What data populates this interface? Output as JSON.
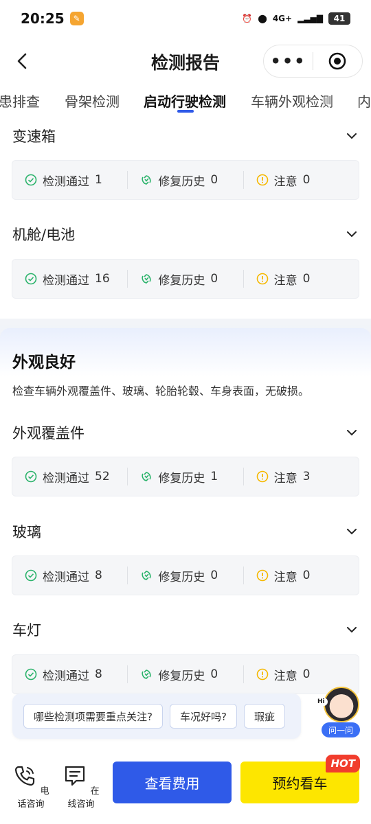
{
  "status_bar": {
    "time": "20:25",
    "network": "4G+",
    "battery": "41"
  },
  "nav": {
    "title": "检测报告",
    "more": "•••"
  },
  "tabs": [
    "患排查",
    "骨架检测",
    "启动行驶检测",
    "车辆外观检测",
    "内"
  ],
  "stat_labels": {
    "pass": "检测通过",
    "repair": "修复历史",
    "attention": "注意"
  },
  "top_sections": [
    {
      "title": "变速箱",
      "pass": "1",
      "repair": "0",
      "attention": "0"
    },
    {
      "title": "机舱/电池",
      "pass": "16",
      "repair": "0",
      "attention": "0"
    }
  ],
  "appearance_group": {
    "title": "外观良好",
    "description": "检查车辆外观覆盖件、玻璃、轮胎轮毂、车身表面，无破损。",
    "sections": [
      {
        "title": "外观覆盖件",
        "pass": "52",
        "repair": "1",
        "attention": "3"
      },
      {
        "title": "玻璃",
        "pass": "8",
        "repair": "0",
        "attention": "0"
      },
      {
        "title": "车灯",
        "pass": "8",
        "repair": "0",
        "attention": "0"
      }
    ]
  },
  "chat": {
    "chips": [
      "哪些检测项需要重点关注?",
      "车况好吗?",
      "瑕疵"
    ],
    "assistant_label": "问一问",
    "hi": "Hi"
  },
  "bottom": {
    "phone": "电话咨询",
    "online": "在线咨询",
    "fee_button": "查看费用",
    "book_button": "预约看车",
    "hot_badge": "HOT"
  },
  "colors": {
    "accent": "#2f5ae8",
    "pass": "#2bb36b",
    "attention": "#f5b800",
    "book": "#fde600"
  }
}
